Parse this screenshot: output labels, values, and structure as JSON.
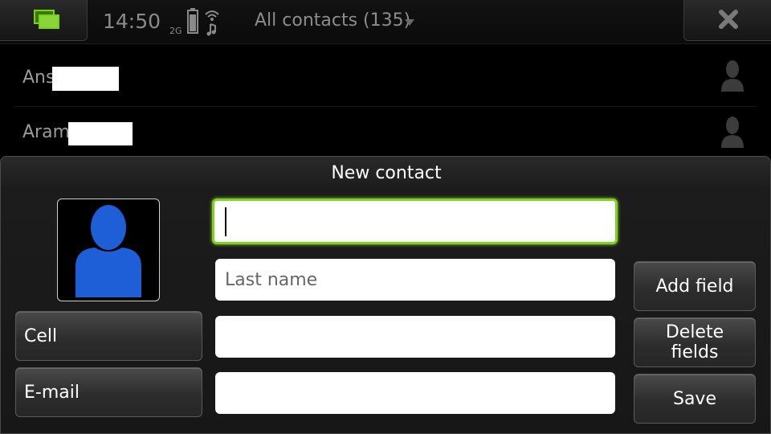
{
  "status_bar": {
    "clock": "14:50",
    "network": "2G",
    "view_title": "All contacts (135)",
    "icons": [
      "task-switcher-icon",
      "battery-icon",
      "signal-icon",
      "dropdown-arrow-icon",
      "close-icon"
    ]
  },
  "contacts": [
    {
      "name": "Ans"
    },
    {
      "name": "Aram"
    }
  ],
  "dialog": {
    "title": "New contact",
    "first_name_value": "",
    "last_name_placeholder": "Last name",
    "field3_value": "",
    "field4_value": "",
    "cell_label": "Cell",
    "email_label": "E-mail",
    "add_field_label": "Add field",
    "delete_fields_label": "Delete fields",
    "save_label": "Save"
  },
  "colors": {
    "accent": "#7ed321",
    "avatar_blue": "#1e5fd8",
    "background": "#000000"
  }
}
